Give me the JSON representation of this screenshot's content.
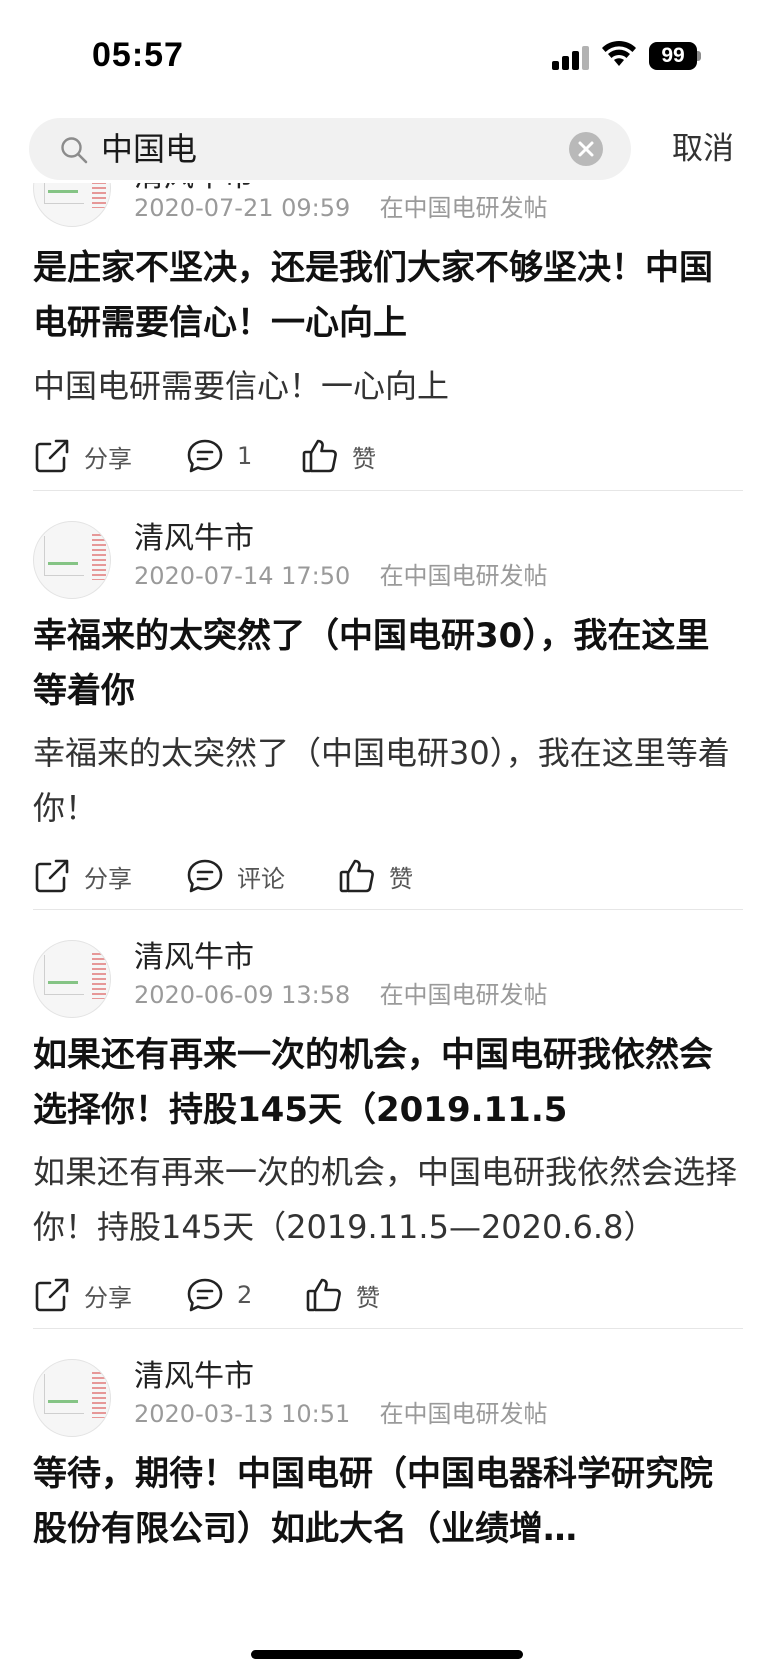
{
  "status_bar": {
    "time": "05:57",
    "battery": "99"
  },
  "search": {
    "query": "中国电",
    "cancel_label": "取消"
  },
  "posts": [
    {
      "author": "清风牛市",
      "date": "2020-07-21 09:59",
      "location": "在中国电研发帖",
      "title": "是庄家不坚决，还是我们大家不够坚决！中国电研需要信心！一心向上",
      "body": "中国电研需要信心！一心向上",
      "share_label": "分享",
      "comment_label": "1",
      "like_label": "赞"
    },
    {
      "author": "清风牛市",
      "date": "2020-07-14 17:50",
      "location": "在中国电研发帖",
      "title": "幸福来的太突然了（中国电研30），我在这里等着你",
      "body": "幸福来的太突然了（中国电研30），我在这里等着你！",
      "share_label": "分享",
      "comment_label": "评论",
      "like_label": "赞"
    },
    {
      "author": "清风牛市",
      "date": "2020-06-09 13:58",
      "location": "在中国电研发帖",
      "title": "如果还有再来一次的机会，中国电研我依然会选择你！持股145天（2019.11.5",
      "body": "如果还有再来一次的机会，中国电研我依然会选择你！持股145天（2019.11.5—2020.6.8）",
      "share_label": "分享",
      "comment_label": "2",
      "like_label": "赞"
    },
    {
      "author": "清风牛市",
      "date": "2020-03-13 10:51",
      "location": "在中国电研发帖",
      "title": "等待，期待！中国电研（中国电器科学研究院股份有限公司）如此大名（业绩增…"
    }
  ]
}
